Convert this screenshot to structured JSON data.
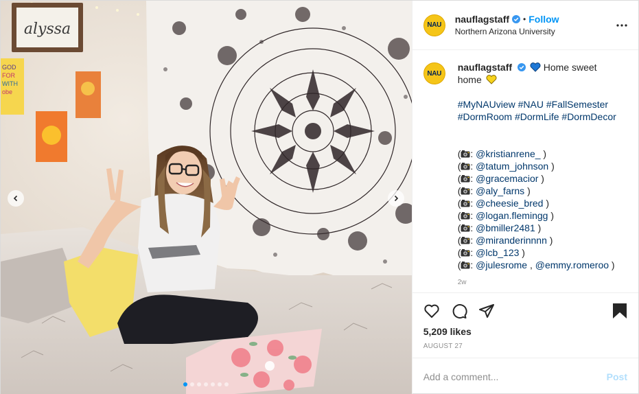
{
  "post": {
    "account": {
      "username": "nauflagstaff",
      "avatar_text": "NAU",
      "verified": true,
      "follow_label": "Follow",
      "separator": "•",
      "location": "Northern Arizona University"
    },
    "caption": {
      "username": "nauflagstaff",
      "text_line1": "Home sweet",
      "text_line2": "home",
      "emoji_1": "blue-heart",
      "emoji_2": "yellow-heart",
      "hashtags_line1": "#MyNAUview #NAU #FallSemester",
      "hashtags_line2": "#DormRoom #DormLife #DormDecor",
      "credits": [
        {
          "mention": "@kristianrene_"
        },
        {
          "mention": "@tatum_johnson"
        },
        {
          "mention": "@gracemacior"
        },
        {
          "mention": "@aly_farns"
        },
        {
          "mention": "@cheesie_bred"
        },
        {
          "mention": "@logan.flemingg"
        },
        {
          "mention": "@bmiller2481"
        },
        {
          "mention": "@miranderinnnn"
        },
        {
          "mention": "@lcb_123"
        },
        {
          "mention": "@julesrome",
          "mention2": "@emmy.romeroo"
        }
      ],
      "time_ago": "2w"
    },
    "likes": "5,209 likes",
    "date": "AUGUST 27",
    "comment_placeholder": "Add a comment...",
    "post_label": "Post",
    "photo": {
      "sign_text": "alyssa",
      "carousel_dots": 7,
      "active_dot": 0
    }
  },
  "colors": {
    "link": "#0095f6",
    "hashtag": "#00376b",
    "nau_gold": "#f5c518",
    "nau_blue": "#002454"
  },
  "icons": [
    "more-options-icon",
    "heart-icon",
    "comment-icon",
    "share-icon",
    "bookmark-icon",
    "camera-emoji-icon",
    "verified-badge-icon",
    "chevron-left-icon",
    "chevron-right-icon"
  ]
}
